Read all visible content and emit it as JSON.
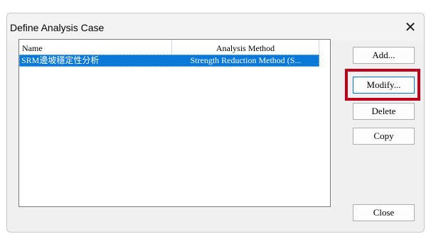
{
  "window": {
    "title": "Define Analysis Case",
    "close_glyph": "✕"
  },
  "list": {
    "columns": [
      "Name",
      "Analysis Method"
    ],
    "rows": [
      {
        "name": "SRM邊坡穩定性分析",
        "method": "Strength Reduction Method (S...",
        "selected": true
      }
    ]
  },
  "buttons": {
    "add": "Add...",
    "modify": "Modify...",
    "delete": "Delete",
    "copy": "Copy",
    "close": "Close"
  },
  "colors": {
    "selection": "#0a78d7",
    "highlight_box": "#c0001a"
  }
}
